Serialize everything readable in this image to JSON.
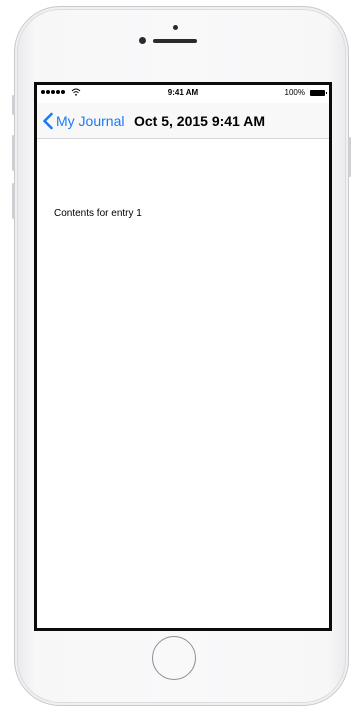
{
  "status_bar": {
    "time": "9:41 AM",
    "battery_percent": "100%",
    "battery_level": 1.0,
    "signal_icon": "signal-dots-icon",
    "wifi_icon": "wifi-icon"
  },
  "nav_bar": {
    "back_label": "My Journal",
    "title": "Oct 5, 2015 9:41 AM",
    "back_icon": "chevron-left-icon"
  },
  "content": {
    "text": "Contents for entry 1"
  },
  "colors": {
    "accent": "#1a7cf5",
    "nav_background": "#f8f8f9",
    "device_frame": "#f9f9fa"
  }
}
